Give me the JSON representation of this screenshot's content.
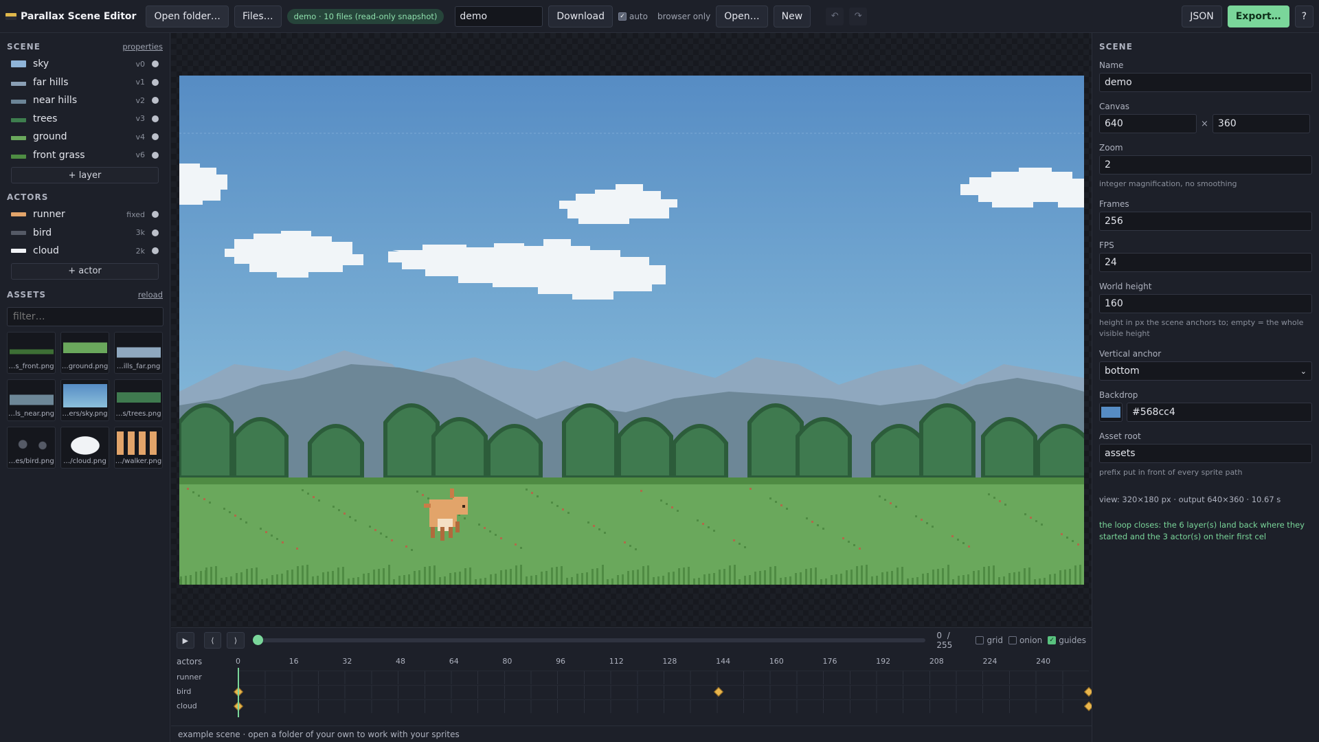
{
  "topbar": {
    "app_title": "Parallax Scene Editor",
    "open_folder": "Open folder…",
    "files": "Files…",
    "snapshot_pill": "demo · 10 files (read-only snapshot)",
    "name_value": "demo",
    "download": "Download",
    "auto_label": "auto",
    "browser_only": "browser only",
    "open": "Open…",
    "new": "New",
    "undo_icon": "undo-icon",
    "redo_icon": "redo-icon",
    "json": "JSON",
    "export": "Export…",
    "help": "?"
  },
  "scene_list": {
    "heading": "SCENE",
    "properties_link": "properties",
    "layers": [
      {
        "name": "sky",
        "tag": "v0",
        "color": "#8fb4d8"
      },
      {
        "name": "far hills",
        "tag": "v1",
        "color": "#8a9fb5"
      },
      {
        "name": "near hills",
        "tag": "v2",
        "color": "#6c8597"
      },
      {
        "name": "trees",
        "tag": "v3",
        "color": "#3e7e4e"
      },
      {
        "name": "ground",
        "tag": "v4",
        "color": "#6aa85c"
      },
      {
        "name": "front grass",
        "tag": "v6",
        "color": "#4e8c43"
      }
    ],
    "add_layer": "+ layer"
  },
  "actors_list": {
    "heading": "ACTORS",
    "actors": [
      {
        "name": "runner",
        "tag": "fixed",
        "color": "#e2a46a"
      },
      {
        "name": "bird",
        "tag": "3k",
        "color": "#555a66"
      },
      {
        "name": "cloud",
        "tag": "2k",
        "color": "#f1f3f6"
      }
    ],
    "add_actor": "+ actor"
  },
  "assets": {
    "heading": "ASSETS",
    "reload_link": "reload",
    "filter_placeholder": "filter…",
    "items": [
      {
        "label": "…s_front.png",
        "kind": "front-grass"
      },
      {
        "label": "…ground.png",
        "kind": "ground"
      },
      {
        "label": "…ills_far.png",
        "kind": "hills-far"
      },
      {
        "label": "…ls_near.png",
        "kind": "hills-near"
      },
      {
        "label": "…ers/sky.png",
        "kind": "sky"
      },
      {
        "label": "…s/trees.png",
        "kind": "trees"
      },
      {
        "label": "…es/bird.png",
        "kind": "bird"
      },
      {
        "label": "…/cloud.png",
        "kind": "cloud"
      },
      {
        "label": "…/walker.png",
        "kind": "walker"
      }
    ]
  },
  "scene_colors": {
    "sky_top": "#568cc4",
    "sky_bottom": "#8cc0dc",
    "far_hills": "#8fa8bf",
    "near_hills": "#6d8797",
    "trees": "#3f7a4f",
    "trees_dark": "#2c5c3a",
    "ground": "#6aa85c",
    "ground_dark": "#4f8b43"
  },
  "timeline": {
    "frame_current": "0",
    "frame_sep": "/",
    "frame_total": "255",
    "grid_label": "grid",
    "onion_label": "onion",
    "guides_label": "guides",
    "header_label": "actors",
    "ticks": [
      "0",
      "16",
      "32",
      "48",
      "64",
      "80",
      "96",
      "112",
      "128",
      "144",
      "160",
      "176",
      "192",
      "208",
      "224",
      "240"
    ],
    "tracks": [
      {
        "name": "runner",
        "keys": []
      },
      {
        "name": "bird",
        "keys": [
          0,
          144,
          255
        ]
      },
      {
        "name": "cloud",
        "keys": [
          0,
          255
        ]
      }
    ],
    "progress": 0
  },
  "status": "example scene · open a folder of your own to work with your sprites",
  "inspector": {
    "heading": "SCENE",
    "name_label": "Name",
    "name_value": "demo",
    "canvas_label": "Canvas",
    "canvas_w": "640",
    "canvas_x": "×",
    "canvas_h": "360",
    "zoom_label": "Zoom",
    "zoom_value": "2",
    "zoom_hint": "integer magnification, no smoothing",
    "frames_label": "Frames",
    "frames_value": "256",
    "fps_label": "FPS",
    "fps_value": "24",
    "world_height_label": "World height",
    "world_height_value": "160",
    "world_height_hint": "height in px the scene anchors to; empty = the whole visible height",
    "vanchor_label": "Vertical anchor",
    "vanchor_value": "bottom",
    "backdrop_label": "Backdrop",
    "backdrop_value": "#568cc4",
    "asset_root_label": "Asset root",
    "asset_root_value": "assets",
    "asset_root_hint": "prefix put in front of every sprite path",
    "view_info": "view: 320×180 px · output 640×360 · 10.67 s",
    "loop_info": "the loop closes: the 6 layer(s) land back where they started and the 3 actor(s) on their first cel"
  }
}
